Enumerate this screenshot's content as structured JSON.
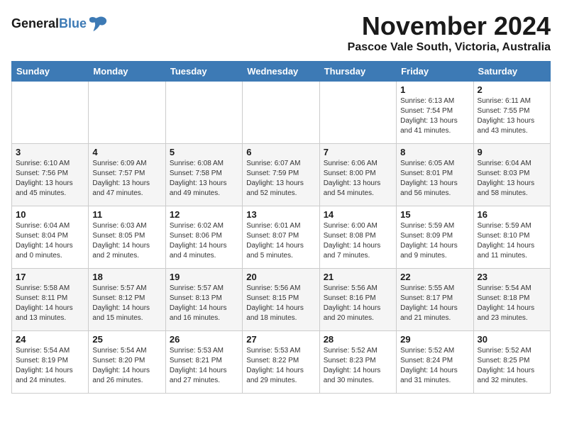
{
  "header": {
    "logo_line1": "General",
    "logo_line2": "Blue",
    "title": "November 2024",
    "subtitle": "Pascoe Vale South, Victoria, Australia"
  },
  "calendar": {
    "days_of_week": [
      "Sunday",
      "Monday",
      "Tuesday",
      "Wednesday",
      "Thursday",
      "Friday",
      "Saturday"
    ],
    "weeks": [
      [
        {
          "day": "",
          "info": ""
        },
        {
          "day": "",
          "info": ""
        },
        {
          "day": "",
          "info": ""
        },
        {
          "day": "",
          "info": ""
        },
        {
          "day": "",
          "info": ""
        },
        {
          "day": "1",
          "info": "Sunrise: 6:13 AM\nSunset: 7:54 PM\nDaylight: 13 hours\nand 41 minutes."
        },
        {
          "day": "2",
          "info": "Sunrise: 6:11 AM\nSunset: 7:55 PM\nDaylight: 13 hours\nand 43 minutes."
        }
      ],
      [
        {
          "day": "3",
          "info": "Sunrise: 6:10 AM\nSunset: 7:56 PM\nDaylight: 13 hours\nand 45 minutes."
        },
        {
          "day": "4",
          "info": "Sunrise: 6:09 AM\nSunset: 7:57 PM\nDaylight: 13 hours\nand 47 minutes."
        },
        {
          "day": "5",
          "info": "Sunrise: 6:08 AM\nSunset: 7:58 PM\nDaylight: 13 hours\nand 49 minutes."
        },
        {
          "day": "6",
          "info": "Sunrise: 6:07 AM\nSunset: 7:59 PM\nDaylight: 13 hours\nand 52 minutes."
        },
        {
          "day": "7",
          "info": "Sunrise: 6:06 AM\nSunset: 8:00 PM\nDaylight: 13 hours\nand 54 minutes."
        },
        {
          "day": "8",
          "info": "Sunrise: 6:05 AM\nSunset: 8:01 PM\nDaylight: 13 hours\nand 56 minutes."
        },
        {
          "day": "9",
          "info": "Sunrise: 6:04 AM\nSunset: 8:03 PM\nDaylight: 13 hours\nand 58 minutes."
        }
      ],
      [
        {
          "day": "10",
          "info": "Sunrise: 6:04 AM\nSunset: 8:04 PM\nDaylight: 14 hours\nand 0 minutes."
        },
        {
          "day": "11",
          "info": "Sunrise: 6:03 AM\nSunset: 8:05 PM\nDaylight: 14 hours\nand 2 minutes."
        },
        {
          "day": "12",
          "info": "Sunrise: 6:02 AM\nSunset: 8:06 PM\nDaylight: 14 hours\nand 4 minutes."
        },
        {
          "day": "13",
          "info": "Sunrise: 6:01 AM\nSunset: 8:07 PM\nDaylight: 14 hours\nand 5 minutes."
        },
        {
          "day": "14",
          "info": "Sunrise: 6:00 AM\nSunset: 8:08 PM\nDaylight: 14 hours\nand 7 minutes."
        },
        {
          "day": "15",
          "info": "Sunrise: 5:59 AM\nSunset: 8:09 PM\nDaylight: 14 hours\nand 9 minutes."
        },
        {
          "day": "16",
          "info": "Sunrise: 5:59 AM\nSunset: 8:10 PM\nDaylight: 14 hours\nand 11 minutes."
        }
      ],
      [
        {
          "day": "17",
          "info": "Sunrise: 5:58 AM\nSunset: 8:11 PM\nDaylight: 14 hours\nand 13 minutes."
        },
        {
          "day": "18",
          "info": "Sunrise: 5:57 AM\nSunset: 8:12 PM\nDaylight: 14 hours\nand 15 minutes."
        },
        {
          "day": "19",
          "info": "Sunrise: 5:57 AM\nSunset: 8:13 PM\nDaylight: 14 hours\nand 16 minutes."
        },
        {
          "day": "20",
          "info": "Sunrise: 5:56 AM\nSunset: 8:15 PM\nDaylight: 14 hours\nand 18 minutes."
        },
        {
          "day": "21",
          "info": "Sunrise: 5:56 AM\nSunset: 8:16 PM\nDaylight: 14 hours\nand 20 minutes."
        },
        {
          "day": "22",
          "info": "Sunrise: 5:55 AM\nSunset: 8:17 PM\nDaylight: 14 hours\nand 21 minutes."
        },
        {
          "day": "23",
          "info": "Sunrise: 5:54 AM\nSunset: 8:18 PM\nDaylight: 14 hours\nand 23 minutes."
        }
      ],
      [
        {
          "day": "24",
          "info": "Sunrise: 5:54 AM\nSunset: 8:19 PM\nDaylight: 14 hours\nand 24 minutes."
        },
        {
          "day": "25",
          "info": "Sunrise: 5:54 AM\nSunset: 8:20 PM\nDaylight: 14 hours\nand 26 minutes."
        },
        {
          "day": "26",
          "info": "Sunrise: 5:53 AM\nSunset: 8:21 PM\nDaylight: 14 hours\nand 27 minutes."
        },
        {
          "day": "27",
          "info": "Sunrise: 5:53 AM\nSunset: 8:22 PM\nDaylight: 14 hours\nand 29 minutes."
        },
        {
          "day": "28",
          "info": "Sunrise: 5:52 AM\nSunset: 8:23 PM\nDaylight: 14 hours\nand 30 minutes."
        },
        {
          "day": "29",
          "info": "Sunrise: 5:52 AM\nSunset: 8:24 PM\nDaylight: 14 hours\nand 31 minutes."
        },
        {
          "day": "30",
          "info": "Sunrise: 5:52 AM\nSunset: 8:25 PM\nDaylight: 14 hours\nand 32 minutes."
        }
      ]
    ]
  }
}
